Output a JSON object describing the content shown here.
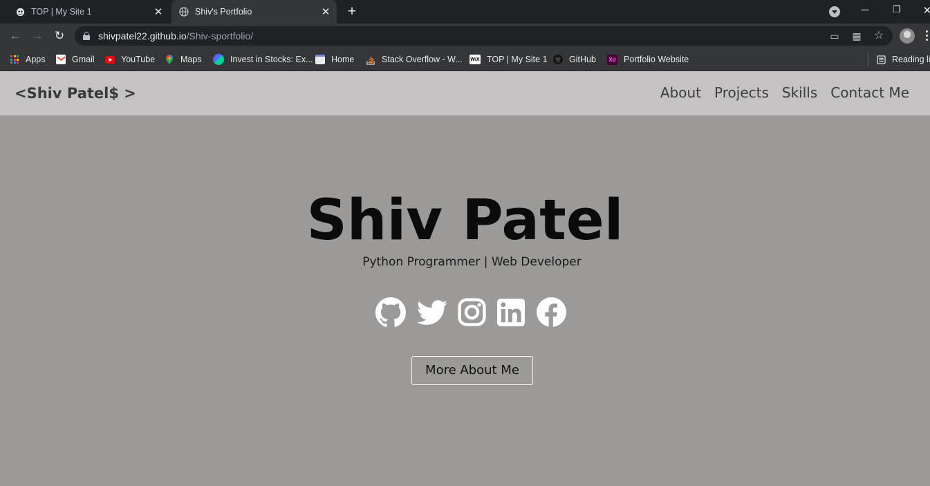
{
  "browser": {
    "tabs": [
      {
        "title": "TOP | My Site 1",
        "favicon": "odin-icon",
        "active": false
      },
      {
        "title": "Shiv's Portfolio",
        "favicon": "globe-icon",
        "active": true
      }
    ],
    "url_host": "shivpatel22.github.io",
    "url_path": "/Shiv-sportfolio/",
    "bookmarks": [
      {
        "label": "Apps",
        "icon": "apps-grid-icon"
      },
      {
        "label": "Gmail",
        "icon": "gmail-icon",
        "color": "#ea4335"
      },
      {
        "label": "YouTube",
        "icon": "youtube-icon",
        "color": "#ff0000"
      },
      {
        "label": "Maps",
        "icon": "maps-icon",
        "color": "#34a853"
      },
      {
        "label": "Invest in Stocks: Ex...",
        "icon": "groww-icon",
        "color": "#00d09c"
      },
      {
        "label": "Home",
        "icon": "page-icon"
      },
      {
        "label": "Stack Overflow - W...",
        "icon": "stackoverflow-icon",
        "color": "#f48024"
      },
      {
        "label": "TOP | My Site 1",
        "icon": "wix-icon"
      },
      {
        "label": "GitHub",
        "icon": "github-icon"
      },
      {
        "label": "Portfolio Website",
        "icon": "adobe-xd-icon",
        "color": "#470137"
      }
    ],
    "reading_list": "Reading lis"
  },
  "site": {
    "brand": "<Shiv Patel$ >",
    "nav": [
      "About",
      "Projects",
      "Skills",
      "Contact Me"
    ],
    "hero": {
      "name": "Shiv Patel",
      "subtitle": "Python Programmer | Web Developer",
      "socials": [
        "github-icon",
        "twitter-icon",
        "instagram-icon",
        "linkedin-icon",
        "facebook-icon"
      ],
      "button": "More About Me"
    }
  },
  "colors": {
    "chrome_dark": "#202124",
    "chrome_toolbar": "#35363a",
    "site_nav_bg": "#c4c2c2",
    "hero_bg": "#9b9a98",
    "icon_white": "#ffffff"
  }
}
